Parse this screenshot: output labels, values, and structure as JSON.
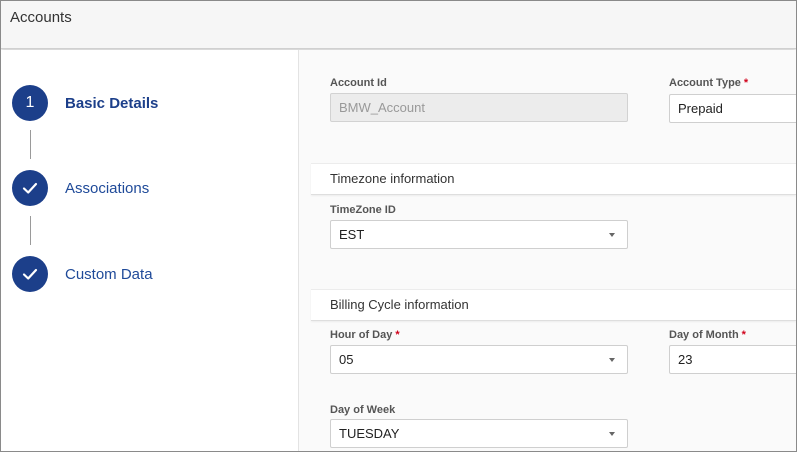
{
  "app": {
    "title": "Accounts"
  },
  "steps": [
    {
      "number": "1",
      "label": "Basic Details",
      "state": "active"
    },
    {
      "label": "Associations",
      "state": "complete",
      "icon": "check-icon"
    },
    {
      "label": "Custom Data",
      "state": "complete",
      "icon": "check-icon"
    }
  ],
  "form": {
    "account_id": {
      "label": "Account Id",
      "value": "BMW_Account",
      "disabled": true
    },
    "account_type": {
      "label": "Account Type",
      "required_marker": "*",
      "value": "Prepaid"
    },
    "timezone_section": {
      "title": "Timezone information"
    },
    "timezone_id": {
      "label": "TimeZone ID",
      "value": "EST"
    },
    "billing_section": {
      "title": "Billing Cycle information"
    },
    "hour_of_day": {
      "label": "Hour of Day",
      "required_marker": "*",
      "value": "05"
    },
    "day_of_month": {
      "label": "Day of Month",
      "required_marker": "*",
      "value": "23"
    },
    "day_of_week": {
      "label": "Day of Week",
      "value": "TUESDAY"
    }
  },
  "colors": {
    "primary": "#1c3f8a",
    "link": "#1f4a99",
    "required": "#d0021b"
  }
}
